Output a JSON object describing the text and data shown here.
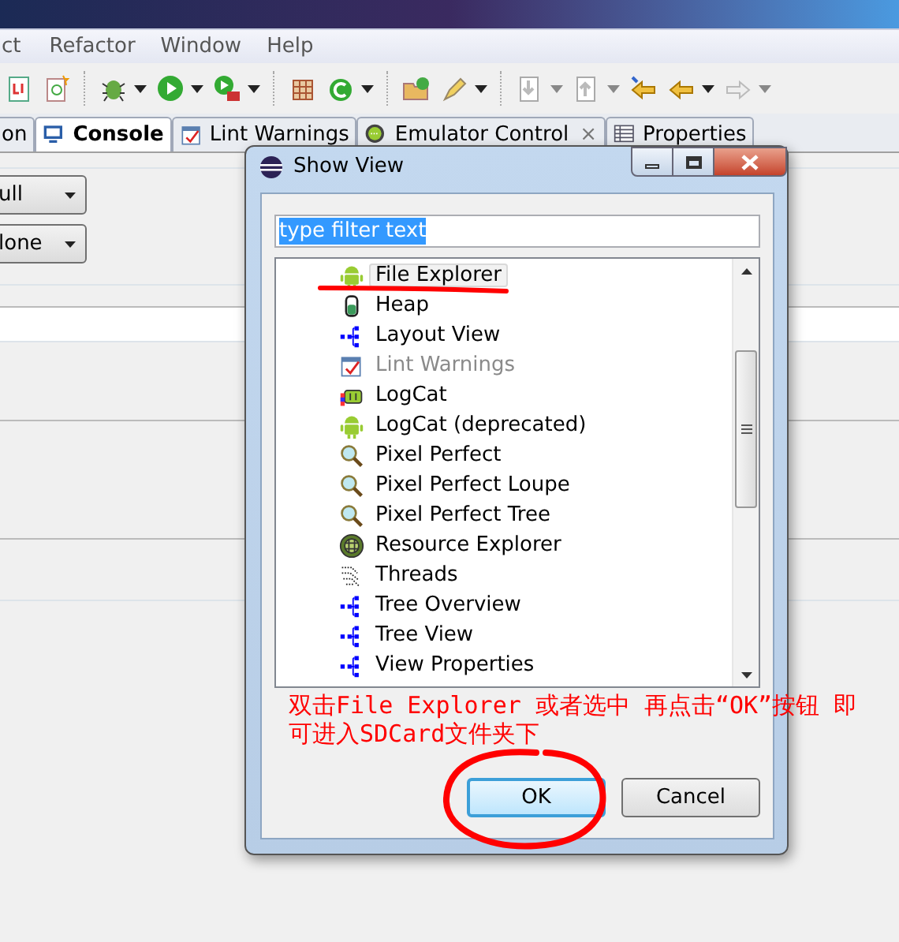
{
  "menu_bar": [
    "ct",
    "Refactor",
    "Window",
    "Help"
  ],
  "tabs": [
    {
      "label": "on",
      "selected": false,
      "kind": "plain",
      "closable": false
    },
    {
      "label": "Console",
      "selected": true,
      "kind": "console",
      "closable": false
    },
    {
      "label": "Lint Warnings",
      "selected": false,
      "kind": "lint",
      "closable": false
    },
    {
      "label": "Emulator Control",
      "selected": false,
      "kind": "emulator",
      "closable": true,
      "close_label": "×"
    },
    {
      "label": "Properties",
      "selected": false,
      "kind": "table",
      "closable": false
    }
  ],
  "combos": [
    {
      "value": "ull"
    },
    {
      "value": "lone"
    }
  ],
  "dialog": {
    "title": "Show View",
    "filter": {
      "value": "type filter text",
      "highlighted": true
    },
    "items": [
      {
        "label": "File Explorer",
        "kind": "android",
        "selected": true,
        "dimmed": false
      },
      {
        "label": "Heap",
        "kind": "heap",
        "selected": false,
        "dimmed": false
      },
      {
        "label": "Layout View",
        "kind": "hierarchy",
        "selected": false,
        "dimmed": false
      },
      {
        "label": "Lint Warnings",
        "kind": "lint",
        "selected": false,
        "dimmed": true
      },
      {
        "label": "LogCat",
        "kind": "logcat",
        "selected": false,
        "dimmed": false
      },
      {
        "label": "LogCat (deprecated)",
        "kind": "android",
        "selected": false,
        "dimmed": false
      },
      {
        "label": "Pixel Perfect",
        "kind": "magnifier",
        "selected": false,
        "dimmed": false
      },
      {
        "label": "Pixel Perfect Loupe",
        "kind": "magnifier",
        "selected": false,
        "dimmed": false
      },
      {
        "label": "Pixel Perfect Tree",
        "kind": "magnifier",
        "selected": false,
        "dimmed": false
      },
      {
        "label": "Resource Explorer",
        "kind": "resource",
        "selected": false,
        "dimmed": false
      },
      {
        "label": "Threads",
        "kind": "threads",
        "selected": false,
        "dimmed": false
      },
      {
        "label": "Tree Overview",
        "kind": "hierarchy",
        "selected": false,
        "dimmed": false
      },
      {
        "label": "Tree View",
        "kind": "hierarchy",
        "selected": false,
        "dimmed": false
      },
      {
        "label": "View Properties",
        "kind": "hierarchy",
        "selected": false,
        "dimmed": false
      }
    ],
    "buttons": [
      {
        "label": "OK",
        "default": true
      },
      {
        "label": "Cancel",
        "default": false
      }
    ]
  },
  "annotation": {
    "text": "双击File Explorer 或者选中 再点击“OK”按钮 即可进入SDCard文件夹下"
  }
}
